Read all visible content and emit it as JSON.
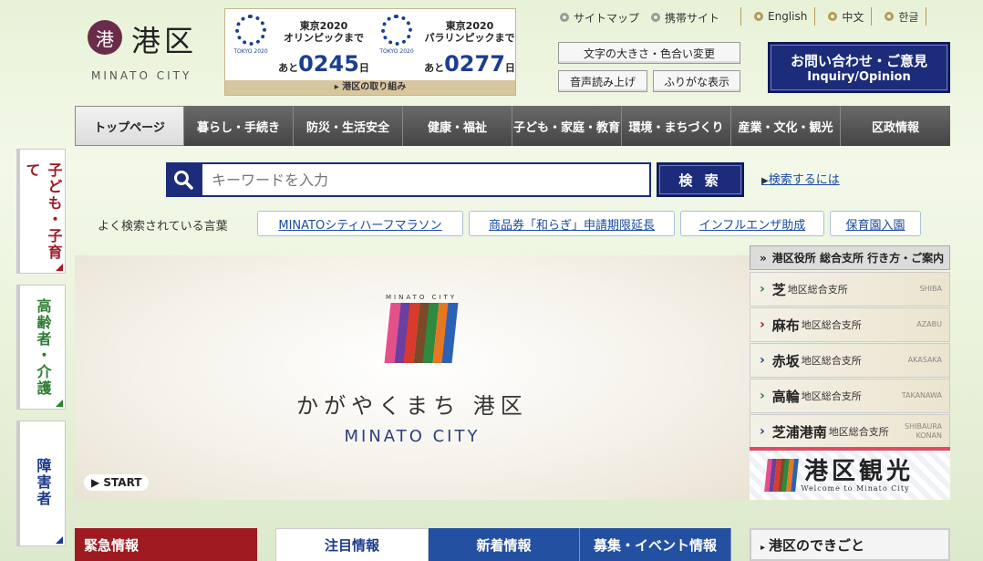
{
  "header": {
    "logo_text": "港区",
    "logo_sub": "MINATO CITY",
    "countdown": [
      {
        "title_line1": "東京2020",
        "title_line2": "オリンピックまで",
        "ato": "あと",
        "days": "0245",
        "unit": "日",
        "emblem_text": "TOKYO 2020"
      },
      {
        "title_line1": "東京2020",
        "title_line2": "パラリンピックまで",
        "ato": "あと",
        "days": "0277",
        "unit": "日",
        "emblem_text": "TOKYO 2020"
      }
    ],
    "countdown_link": "▸ 港区の取り組み",
    "sitemap": "サイトマップ",
    "mobile": "携帯サイト",
    "languages": [
      "English",
      "中文",
      "한글"
    ],
    "text_size_button": "文字の大きさ・色合い変更",
    "read_aloud_button": "音声読み上げ",
    "furigana_button": "ふりがな表示",
    "inquiry_line1": "お問い合わせ・ご意見",
    "inquiry_line2": "Inquiry/Opinion"
  },
  "nav": [
    "トップページ",
    "暮らし・手続き",
    "防災・生活安全",
    "健康・福祉",
    "子ども・家庭・教育",
    "環境・まちづくり",
    "産業・文化・観光",
    "区政情報"
  ],
  "side_tabs": [
    {
      "label": "子ども・子育て",
      "color": "#a01a22"
    },
    {
      "label": "高齢者・介護",
      "color": "#2e7d32"
    },
    {
      "label": "障害者",
      "color": "#1c3a8a"
    }
  ],
  "search": {
    "placeholder": "キーワードを入力",
    "button": "検 索",
    "help": "検索するには",
    "popular_label": "よく検索されている言葉",
    "keywords": [
      "MINATOシティハーフマラソン",
      "商品券「和らぎ」申請期限延長",
      "インフルエンザ助成",
      "保育園入園"
    ]
  },
  "hero": {
    "small_text": "MINATO CITY",
    "title": "かがやくまち 港区",
    "subtitle": "MINATO CITY",
    "start_label": "START",
    "bar_colors": [
      "#e3508a",
      "#6c3fa0",
      "#d93a2b",
      "#7a4a2a",
      "#2d8a3e",
      "#e87722",
      "#2c62b4"
    ]
  },
  "branches": {
    "header": "港区役所 総合支所 行き方・ご案内",
    "items": [
      {
        "name": "芝",
        "suffix": "地区総合支所",
        "en": "SHIBA",
        "color": "#2e7d32"
      },
      {
        "name": "麻布",
        "suffix": "地区総合支所",
        "en": "AZABU",
        "color": "#a01a22"
      },
      {
        "name": "赤坂",
        "suffix": "地区総合支所",
        "en": "AKASAKA",
        "color": "#1c3a8a"
      },
      {
        "name": "高輪",
        "suffix": "地区総合支所",
        "en": "TAKANAWA",
        "color": "#2e7d32"
      },
      {
        "name": "芝浦港南",
        "suffix": "地区総合支所",
        "en": "SHIBAURA KONAN",
        "color": "#1c3a8a"
      }
    ]
  },
  "tourism": {
    "title": "港区観光",
    "subtitle": "Welcome to Minato City"
  },
  "bottom": {
    "emergency": "緊急情報",
    "tabs": [
      "注目情報",
      "新着情報",
      "募集・イベント情報"
    ],
    "events": "港区のできごと"
  }
}
